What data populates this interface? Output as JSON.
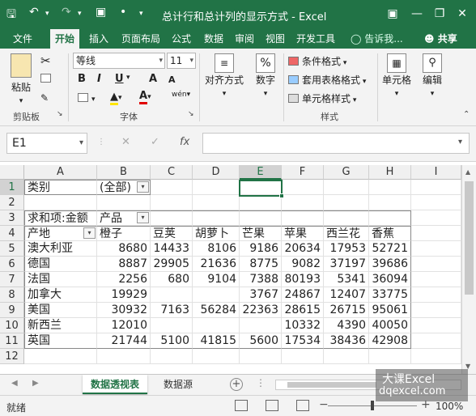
{
  "window": {
    "title": "总计行和总计列的显示方式 - Excel",
    "accent_color": "#217346"
  },
  "ribbon_tabs": [
    "文件",
    "开始",
    "插入",
    "页面布局",
    "公式",
    "数据",
    "审阅",
    "视图",
    "开发工具"
  ],
  "active_tab": "开始",
  "tell_me": "告诉我...",
  "share": "共享",
  "ribbon": {
    "paste": "粘贴",
    "clipboard_group": "剪贴板",
    "font_name": "等线",
    "font_size": "11",
    "font_group": "字体",
    "bold": "B",
    "italic": "I",
    "underline": "U",
    "grow": "A",
    "shrink": "A",
    "font_color_letter": "A",
    "phonetic": "wén",
    "alignment": "对齐方式",
    "number": "数字",
    "percent": "%",
    "conditional_format": "条件格式",
    "table_format": "套用表格格式",
    "cell_style": "单元格样式",
    "styles_group": "样式",
    "cells": "单元格",
    "editing": "编辑"
  },
  "formula_bar": {
    "name_box": "E1",
    "cancel_icon": "✕",
    "enter_icon": "✓",
    "fx": "fx",
    "formula": ""
  },
  "grid": {
    "columns": [
      "A",
      "B",
      "C",
      "D",
      "E",
      "F",
      "G",
      "H",
      "I"
    ],
    "rows": [
      "1",
      "2",
      "3",
      "4",
      "5",
      "6",
      "7",
      "8",
      "9",
      "10",
      "11",
      "12"
    ],
    "selected_cell": "E1",
    "r1": {
      "a": "类别",
      "b": "(全部)"
    },
    "r3": {
      "a": "求和项:金额",
      "b": "产品"
    },
    "headers": [
      "产地",
      "橙子",
      "豆荚",
      "胡萝卜",
      "芒果",
      "苹果",
      "西兰花",
      "香蕉"
    ],
    "data": [
      [
        "澳大利亚",
        "8680",
        "14433",
        "8106",
        "9186",
        "20634",
        "17953",
        "52721"
      ],
      [
        "德国",
        "8887",
        "29905",
        "21636",
        "8775",
        "9082",
        "37197",
        "39686"
      ],
      [
        "法国",
        "2256",
        "680",
        "9104",
        "7388",
        "80193",
        "5341",
        "36094"
      ],
      [
        "加拿大",
        "19929",
        "",
        "",
        "3767",
        "24867",
        "12407",
        "33775"
      ],
      [
        "美国",
        "30932",
        "7163",
        "56284",
        "22363",
        "28615",
        "26715",
        "95061"
      ],
      [
        "新西兰",
        "12010",
        "",
        "",
        "",
        "10332",
        "4390",
        "40050"
      ],
      [
        "英国",
        "21744",
        "5100",
        "41815",
        "5600",
        "17534",
        "38436",
        "42908"
      ]
    ]
  },
  "sheets": [
    "数据透视表",
    "数据源"
  ],
  "active_sheet": "数据透视表",
  "status": {
    "ready": "就绪",
    "zoom": "100%"
  },
  "watermark": {
    "line1": "大课Excel",
    "line2": "dqexcel.com"
  }
}
